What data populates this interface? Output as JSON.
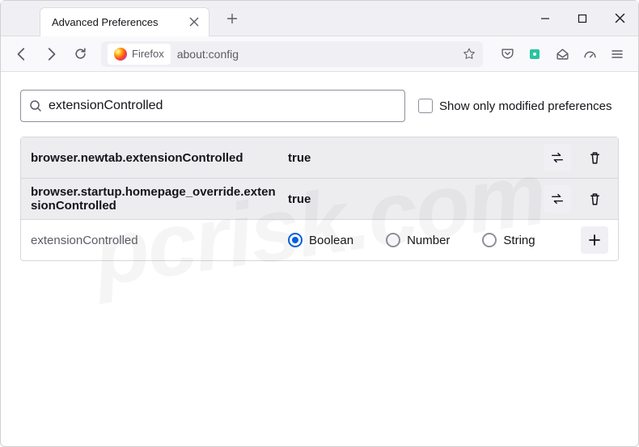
{
  "window": {
    "tab_title": "Advanced Preferences"
  },
  "toolbar": {
    "identity_label": "Firefox",
    "url": "about:config"
  },
  "config": {
    "search_value": "extensionControlled",
    "show_modified_label": "Show only modified preferences",
    "results": [
      {
        "name": "browser.newtab.extensionControlled",
        "value": "true"
      },
      {
        "name": "browser.startup.homepage_override.extensionControlled",
        "value": "true"
      }
    ],
    "add_row": {
      "name": "extensionControlled",
      "types": {
        "boolean": "Boolean",
        "number": "Number",
        "string": "String"
      },
      "selected": "boolean"
    }
  },
  "watermark": "pcrisk.com"
}
